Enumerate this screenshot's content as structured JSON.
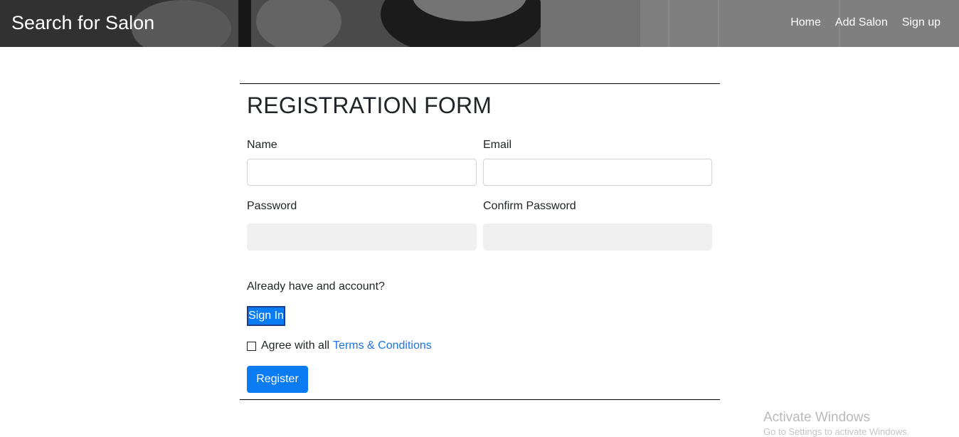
{
  "header": {
    "brand": "Search for Salon",
    "nav": [
      {
        "label": "Home"
      },
      {
        "label": "Add Salon"
      },
      {
        "label": "Sign up"
      }
    ]
  },
  "form": {
    "title": "REGISTRATION FORM",
    "name_label": "Name",
    "name_value": "",
    "email_label": "Email",
    "email_value": "",
    "password_label": "Password",
    "password_value": "",
    "confirm_password_label": "Confirm Password",
    "confirm_password_value": "",
    "account_prompt": "Already have and account?",
    "signin_label": "Sign In",
    "agree_text": "Agree with all",
    "terms_link": "Terms & Conditions",
    "agree_checked": false,
    "register_label": "Register"
  },
  "watermark": {
    "line1": "Activate Windows",
    "line2": "Go to Settings to activate Windows."
  },
  "colors": {
    "primary": "#0a7bf1",
    "link": "#1a73e8",
    "border": "#000000"
  }
}
